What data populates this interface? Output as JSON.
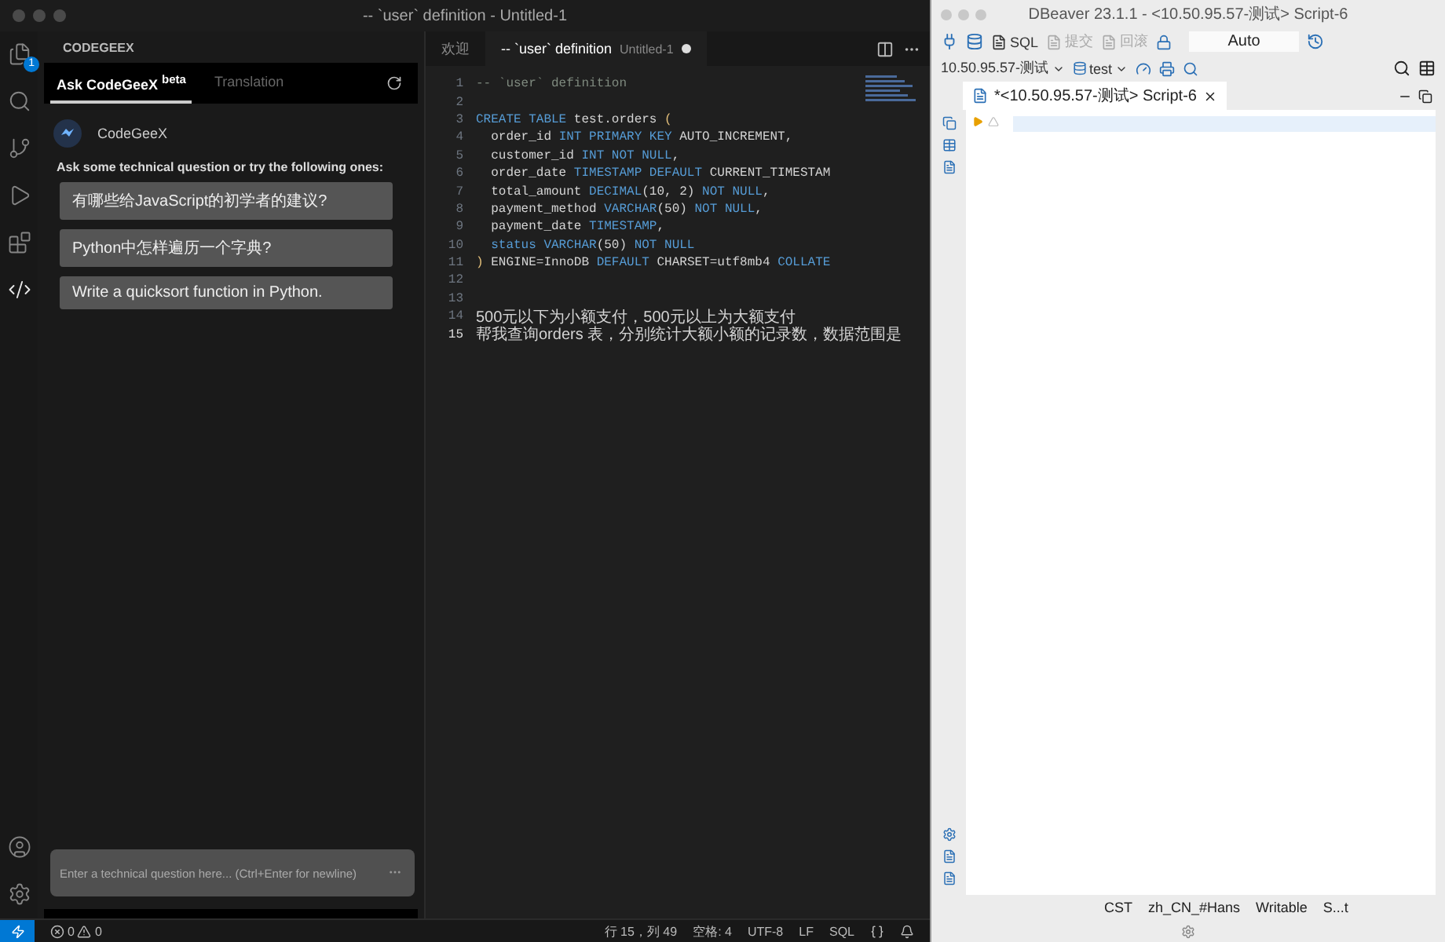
{
  "vscode": {
    "title": "-- `user` definition - Untitled-1",
    "activity_bar": [
      {
        "kind": "files",
        "badge": "1",
        "selected": false
      },
      {
        "kind": "search",
        "selected": false
      },
      {
        "kind": "source-control",
        "selected": false
      },
      {
        "kind": "run",
        "selected": false
      },
      {
        "kind": "extensions",
        "selected": false
      },
      {
        "kind": "codegeex",
        "selected": true
      }
    ],
    "panel": {
      "title": "CODEGEEX",
      "tabs": [
        {
          "label": "Ask CodeGeeX $^{beta}$",
          "selected": true
        },
        {
          "label": "Translation",
          "selected": false
        }
      ],
      "bot_name": "CodeGeeX",
      "prompt": "Ask some technical question or try the following ones:",
      "suggestions": [
        "有哪些给JavaScript的初学者的建议?",
        "Python中怎样遍历一个字典?",
        "Write a quicksort function in Python."
      ],
      "input": {
        "placeholder": "Enter a technical question here... (Ctrl+Enter for newline)"
      }
    },
    "editor_tabs": [
      {
        "label": "欢迎",
        "selected": false,
        "modified": false
      },
      {
        "label": "-- `user` definition",
        "detail": "Untitled-1",
        "selected": true,
        "modified": true
      }
    ],
    "lines": [
      {
        "number": "1",
        "current": false,
        "segments": [
          {
            "kind": "comment",
            "text": "-- `user` definition"
          }
        ]
      },
      {
        "number": "2",
        "current": false
      },
      {
        "number": "3",
        "current": false,
        "segments": [
          {
            "kind": "keyword",
            "text": "CREATE TABLE"
          },
          {
            "kind": "text",
            "text": " test.orders "
          },
          {
            "kind": "bracket",
            "text": "("
          }
        ]
      },
      {
        "number": "4",
        "current": false,
        "segments": [
          {
            "kind": "text",
            "text": "  order_id "
          },
          {
            "kind": "keyword",
            "text": "INT PRIMARY KEY"
          },
          {
            "kind": "text",
            "text": " AUTO_INCREMENT,"
          }
        ]
      },
      {
        "number": "5",
        "current": false,
        "segments": [
          {
            "kind": "text",
            "text": "  customer_id "
          },
          {
            "kind": "keyword",
            "text": "INT NOT NULL"
          },
          {
            "kind": "text",
            "text": ","
          }
        ]
      },
      {
        "number": "6",
        "current": false,
        "segments": [
          {
            "kind": "text",
            "text": "  order_date "
          },
          {
            "kind": "keyword",
            "text": "TIMESTAMP DEFAULT"
          },
          {
            "kind": "text",
            "text": " CURRENT_TIMESTAM"
          }
        ]
      },
      {
        "number": "7",
        "current": false,
        "segments": [
          {
            "kind": "text",
            "text": "  total_amount "
          },
          {
            "kind": "keyword",
            "text": "DECIMAL"
          },
          {
            "kind": "text",
            "text": "(10, 2) "
          },
          {
            "kind": "keyword",
            "text": "NOT NULL"
          },
          {
            "kind": "text",
            "text": ","
          }
        ]
      },
      {
        "number": "8",
        "current": false,
        "segments": [
          {
            "kind": "text",
            "text": "  payment_method "
          },
          {
            "kind": "keyword",
            "text": "VARCHAR"
          },
          {
            "kind": "text",
            "text": "(50) "
          },
          {
            "kind": "keyword",
            "text": "NOT NULL"
          },
          {
            "kind": "text",
            "text": ","
          }
        ]
      },
      {
        "number": "9",
        "current": false,
        "segments": [
          {
            "kind": "text",
            "text": "  payment_date "
          },
          {
            "kind": "keyword",
            "text": "TIMESTAMP"
          },
          {
            "kind": "text",
            "text": ","
          }
        ]
      },
      {
        "number": "10",
        "current": false,
        "segments": [
          {
            "kind": "keyword",
            "text": "  status VARCHAR"
          },
          {
            "kind": "text",
            "text": "(50) "
          },
          {
            "kind": "keyword",
            "text": "NOT NULL"
          }
        ]
      },
      {
        "number": "11",
        "current": false,
        "segments": [
          {
            "kind": "bracket",
            "text": ")"
          },
          {
            "kind": "text",
            "text": " ENGINE=InnoDB "
          },
          {
            "kind": "keyword",
            "text": "DEFAULT"
          },
          {
            "kind": "text",
            "text": " CHARSET=utf8mb4 "
          },
          {
            "kind": "keyword",
            "text": "COLLATE"
          }
        ]
      },
      {
        "number": "12",
        "current": false
      },
      {
        "number": "13",
        "current": false
      },
      {
        "number": "14",
        "current": false,
        "segments": [
          {
            "kind": "note",
            "text": "500元以下为小额支付，500元以上为大额支付"
          }
        ]
      },
      {
        "number": "15",
        "current": true,
        "segments": [
          {
            "kind": "note",
            "text": "帮我查询orders 表，分别统计大额小额的记录数，数据范围是"
          }
        ]
      }
    ],
    "status_bar": {
      "errors": "0",
      "warnings": "0",
      "items": [
        "行 15，列 49",
        "空格: 4",
        "UTF-8",
        "LF",
        "SQL"
      ]
    }
  },
  "dbeaver": {
    "title": "DBeaver 23.1.1 - <10.50.95.57-测试> Script-6",
    "toolbar": [
      {
        "label": "SQL",
        "disabled": false
      },
      {
        "label": "提交",
        "disabled": true
      },
      {
        "label": "回滚",
        "disabled": true
      }
    ],
    "mode": "Auto",
    "connection": "10.50.95.57-测试",
    "schema": "test",
    "tab": {
      "label": "*<10.50.95.57-测试> Script-6",
      "selected": true
    },
    "status_bar": [
      "CST",
      "zh_CN_#Hans",
      "Writable",
      "S...t"
    ]
  }
}
